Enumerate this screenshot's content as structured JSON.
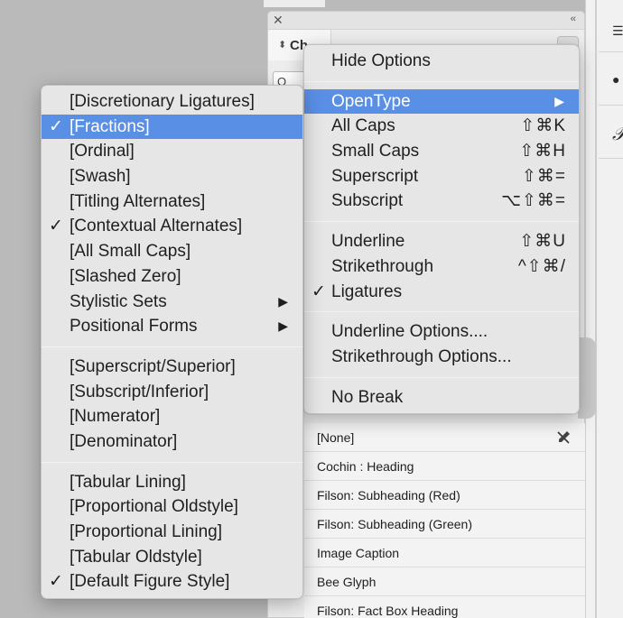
{
  "panel": {
    "title": "Character",
    "title_visible": "Ch",
    "close_icon": "close-icon",
    "collapse_label": "‹‹",
    "search_value": "O"
  },
  "main_menu": {
    "items": [
      {
        "label": "Hide Options",
        "shortcut": "",
        "checked": false,
        "submenu": false,
        "highlighted": false
      },
      {
        "separator": true
      },
      {
        "label": "OpenType",
        "shortcut": "",
        "checked": false,
        "submenu": true,
        "highlighted": true
      },
      {
        "label": "All Caps",
        "shortcut": "⇧⌘K",
        "checked": false,
        "submenu": false,
        "highlighted": false
      },
      {
        "label": "Small Caps",
        "shortcut": "⇧⌘H",
        "checked": false,
        "submenu": false,
        "highlighted": false
      },
      {
        "label": "Superscript",
        "shortcut": "⇧⌘=",
        "checked": false,
        "submenu": false,
        "highlighted": false
      },
      {
        "label": "Subscript",
        "shortcut": "⌥⇧⌘=",
        "checked": false,
        "submenu": false,
        "highlighted": false
      },
      {
        "separator": true
      },
      {
        "label": "Underline",
        "shortcut": "⇧⌘U",
        "checked": false,
        "submenu": false,
        "highlighted": false
      },
      {
        "label": "Strikethrough",
        "shortcut": "^⇧⌘/",
        "checked": false,
        "submenu": false,
        "highlighted": false
      },
      {
        "label": "Ligatures",
        "shortcut": "",
        "checked": true,
        "submenu": false,
        "highlighted": false
      },
      {
        "separator": true
      },
      {
        "label": "Underline Options....",
        "shortcut": "",
        "checked": false,
        "submenu": false,
        "highlighted": false
      },
      {
        "label": "Strikethrough Options...",
        "shortcut": "",
        "checked": false,
        "submenu": false,
        "highlighted": false
      },
      {
        "separator": true
      },
      {
        "label": "No Break",
        "shortcut": "",
        "checked": false,
        "submenu": false,
        "highlighted": false
      }
    ]
  },
  "opentype_menu": {
    "items": [
      {
        "label": "[Discretionary Ligatures]",
        "checked": false,
        "submenu": false,
        "highlighted": false
      },
      {
        "label": "[Fractions]",
        "checked": true,
        "submenu": false,
        "highlighted": true
      },
      {
        "label": "[Ordinal]",
        "checked": false,
        "submenu": false,
        "highlighted": false
      },
      {
        "label": "[Swash]",
        "checked": false,
        "submenu": false,
        "highlighted": false
      },
      {
        "label": "[Titling Alternates]",
        "checked": false,
        "submenu": false,
        "highlighted": false
      },
      {
        "label": "[Contextual Alternates]",
        "checked": true,
        "submenu": false,
        "highlighted": false
      },
      {
        "label": "[All Small Caps]",
        "checked": false,
        "submenu": false,
        "highlighted": false
      },
      {
        "label": "[Slashed Zero]",
        "checked": false,
        "submenu": false,
        "highlighted": false
      },
      {
        "label": "Stylistic Sets",
        "checked": false,
        "submenu": true,
        "highlighted": false
      },
      {
        "label": "Positional Forms",
        "checked": false,
        "submenu": true,
        "highlighted": false
      },
      {
        "separator": true
      },
      {
        "label": "[Superscript/Superior]",
        "checked": false,
        "submenu": false,
        "highlighted": false
      },
      {
        "label": "[Subscript/Inferior]",
        "checked": false,
        "submenu": false,
        "highlighted": false
      },
      {
        "label": "[Numerator]",
        "checked": false,
        "submenu": false,
        "highlighted": false
      },
      {
        "label": "[Denominator]",
        "checked": false,
        "submenu": false,
        "highlighted": false
      },
      {
        "separator": true
      },
      {
        "label": "[Tabular Lining]",
        "checked": false,
        "submenu": false,
        "highlighted": false
      },
      {
        "label": "[Proportional Oldstyle]",
        "checked": false,
        "submenu": false,
        "highlighted": false
      },
      {
        "label": "[Proportional Lining]",
        "checked": false,
        "submenu": false,
        "highlighted": false
      },
      {
        "label": "[Tabular Oldstyle]",
        "checked": false,
        "submenu": false,
        "highlighted": false
      },
      {
        "label": "[Default Figure Style]",
        "checked": true,
        "submenu": false,
        "highlighted": false
      }
    ]
  },
  "character_styles": {
    "items": [
      {
        "label": "[None]",
        "icon": "clear-overrides-icon"
      },
      {
        "label": "Cochin : Heading"
      },
      {
        "label": "Filson: Subheading (Red)"
      },
      {
        "label": "Filson: Subheading (Green)"
      },
      {
        "label": "Image Caption"
      },
      {
        "label": "Bee Glyph"
      },
      {
        "label": "Filson: Fact Box Heading"
      }
    ]
  },
  "symbols": {
    "check": "✓",
    "submenu_arrow": "▶",
    "updown": "◇"
  },
  "colors": {
    "highlight": "#5a8fe6",
    "menu_bg": "#e6e6e6",
    "backdrop": "#bababa"
  }
}
